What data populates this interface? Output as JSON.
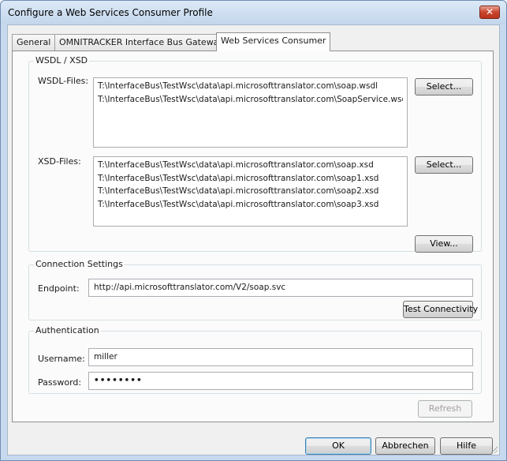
{
  "window": {
    "title": "Configure a Web Services Consumer Profile",
    "close_glyph": "✕",
    "colors": {
      "titlebar": "#c3d6ec",
      "close": "#c9452c",
      "accent": "#3c7fb1"
    }
  },
  "tabs": [
    {
      "label": "General"
    },
    {
      "label": "OMNITRACKER Interface Bus Gateway"
    },
    {
      "label": "Web Services Consumer",
      "active": true
    }
  ],
  "wsdl_xsd": {
    "group_label": "WSDL / XSD",
    "wsdl_label": "WSDL-Files:",
    "wsdl_files": [
      "T:\\InterfaceBus\\TestWsc\\data\\api.microsofttranslator.com\\soap.wsdl",
      "T:\\InterfaceBus\\TestWsc\\data\\api.microsofttranslator.com\\SoapService.wsdl"
    ],
    "wsdl_select_label": "Select...",
    "xsd_label": "XSD-Files:",
    "xsd_files": [
      "T:\\InterfaceBus\\TestWsc\\data\\api.microsofttranslator.com\\soap.xsd",
      "T:\\InterfaceBus\\TestWsc\\data\\api.microsofttranslator.com\\soap1.xsd",
      "T:\\InterfaceBus\\TestWsc\\data\\api.microsofttranslator.com\\soap2.xsd",
      "T:\\InterfaceBus\\TestWsc\\data\\api.microsofttranslator.com\\soap3.xsd"
    ],
    "xsd_select_label": "Select...",
    "view_label": "View..."
  },
  "connection": {
    "group_label": "Connection Settings",
    "endpoint_label": "Endpoint:",
    "endpoint_value": "http://api.microsofttranslator.com/V2/soap.svc",
    "test_label": "Test Connectivity"
  },
  "auth": {
    "group_label": "Authentication",
    "username_label": "Username:",
    "username_value": "miller",
    "password_label": "Password:",
    "password_value": "••••••••"
  },
  "refresh_label": "Refresh",
  "footer": {
    "ok_label": "OK",
    "cancel_label": "Abbrechen",
    "help_label": "Hilfe"
  }
}
